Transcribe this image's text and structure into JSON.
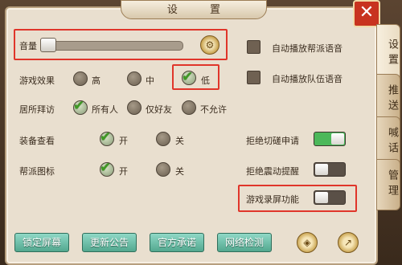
{
  "window": {
    "title": "设 置"
  },
  "volume": {
    "label": "音量",
    "level": 0.05
  },
  "game_effect": {
    "label": "游戏效果",
    "options": [
      "高",
      "中",
      "低"
    ],
    "selected": "低"
  },
  "home_visit": {
    "label": "居所拜访",
    "options": [
      "所有人",
      "仅好友",
      "不允许"
    ],
    "selected": "所有人"
  },
  "equipment_view": {
    "label": "装备查看",
    "options": [
      "开",
      "关"
    ],
    "selected": "开"
  },
  "guild_icon": {
    "label": "帮派图标",
    "options": [
      "开",
      "关"
    ],
    "selected": "开"
  },
  "right_options": {
    "auto_guild_voice": {
      "label": "自动播放帮派语音",
      "checked": false
    },
    "auto_team_voice": {
      "label": "自动播放队伍语音",
      "checked": false
    },
    "refuse_duel": {
      "label": "拒绝切磋申请",
      "on": true
    },
    "refuse_vibration": {
      "label": "拒绝震动提醒",
      "on": false
    },
    "screen_record": {
      "label": "游戏录屏功能",
      "on": false
    }
  },
  "bottom_buttons": [
    "锁定屏幕",
    "更新公告",
    "官方承诺",
    "网络检测"
  ],
  "side_tabs": [
    "设置",
    "推送",
    "喊话",
    "管理"
  ],
  "colors": {
    "highlight": "#e0352a",
    "toggle_on": "#4cb85a",
    "button": "#53a88f"
  }
}
